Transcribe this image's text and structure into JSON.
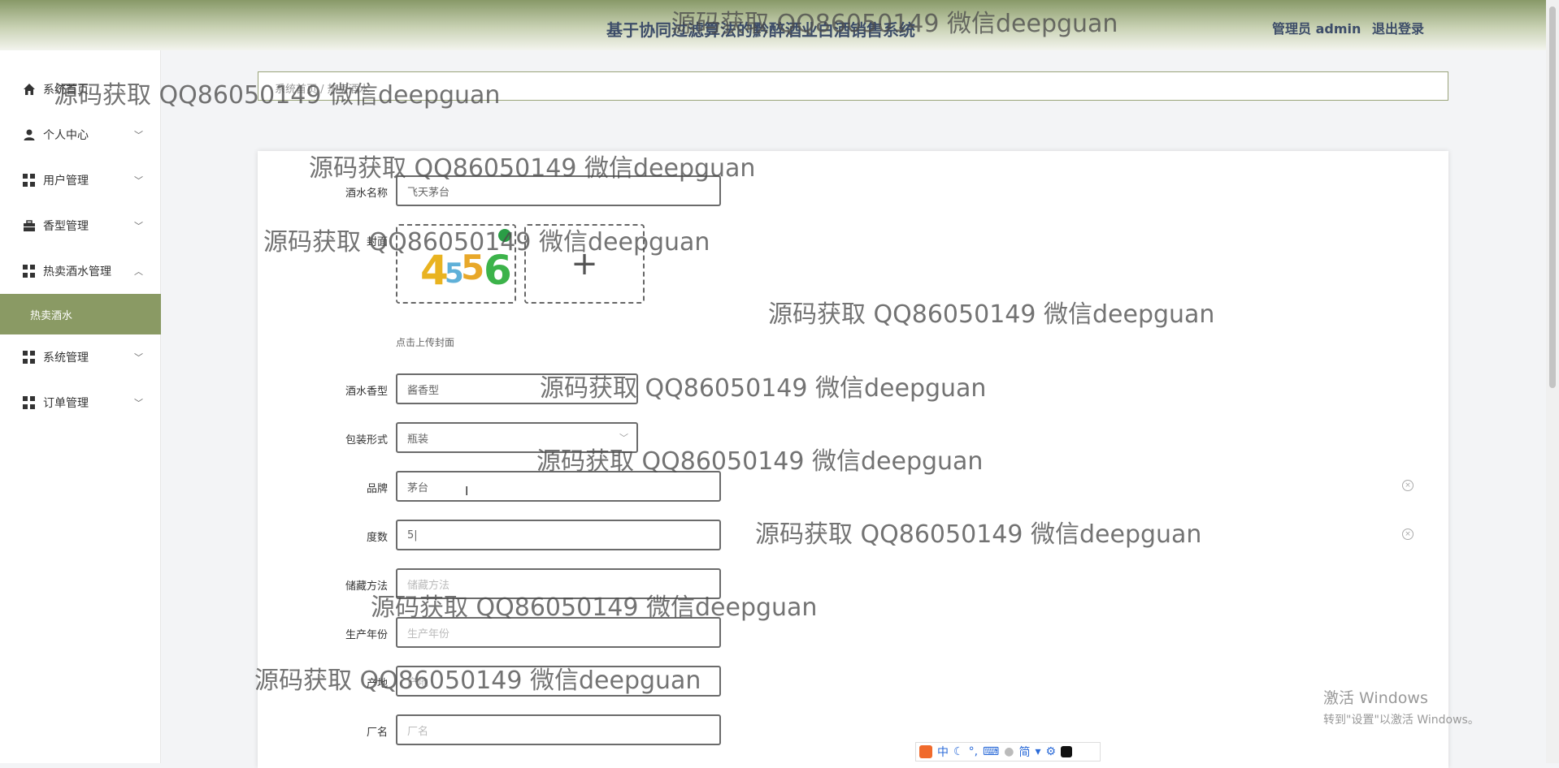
{
  "header": {
    "title": "基于协同过滤算法的黔醉酒业白酒销售系统",
    "user_label": "管理员 admin",
    "logout_label": "退出登录"
  },
  "sidebar": {
    "items": [
      {
        "label": "系统首页",
        "icon": "home-icon"
      },
      {
        "label": "个人中心",
        "icon": "user-icon"
      },
      {
        "label": "用户管理",
        "icon": "grid-icon"
      },
      {
        "label": "香型管理",
        "icon": "briefcase-icon"
      },
      {
        "label": "热卖酒水管理",
        "icon": "grid-icon"
      },
      {
        "label": "热卖酒水",
        "icon": ""
      },
      {
        "label": "系统管理",
        "icon": "grid-icon"
      },
      {
        "label": "订单管理",
        "icon": "grid-icon"
      }
    ]
  },
  "breadcrumb": {
    "text": "系统首页 / 热卖酒水"
  },
  "form": {
    "name_label": "酒水名称",
    "name_value": "飞天茅台",
    "cover_label": "封面",
    "cover_hint": "点击上传封面",
    "aroma_label": "酒水香型",
    "aroma_value": "酱香型",
    "package_label": "包装形式",
    "package_value": "瓶装",
    "brand_label": "品牌",
    "brand_value": "茅台",
    "degree_label": "度数",
    "degree_value": "5|",
    "storage_label": "储藏方法",
    "storage_placeholder": "储藏方法",
    "year_label": "生产年份",
    "year_placeholder": "生产年份",
    "origin_label": "产地",
    "origin_placeholder": "产地",
    "factory_label": "厂名",
    "factory_placeholder": "厂名"
  },
  "watermark": {
    "text": "源码获取 QQ86050149 微信deepguan"
  },
  "windows": {
    "line1": "激活 Windows",
    "line2": "转到\"设置\"以激活 Windows。"
  },
  "ime": {
    "lang": "中",
    "simplified": "简"
  },
  "colors": {
    "accent": "#8a9a64",
    "title": "#3d4d69"
  }
}
